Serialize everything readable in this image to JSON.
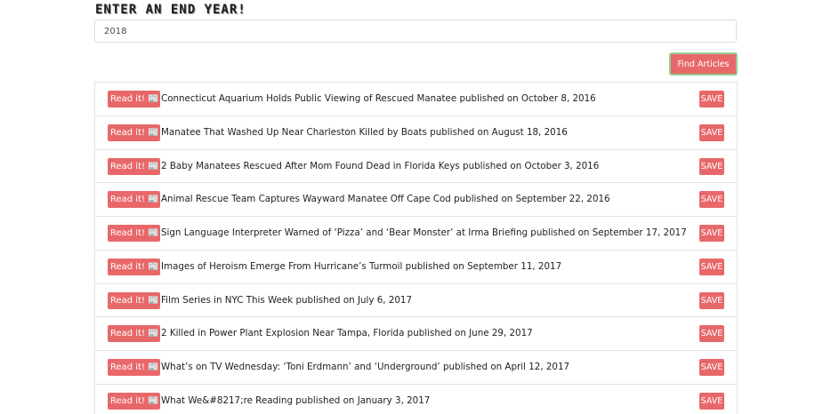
{
  "search": {
    "heading": "Enter an End Year!",
    "end_year_value": "2018",
    "find_button_label": "Find Articles"
  },
  "articles": {
    "read_label": "Read it!",
    "read_icon": "newspaper-icon",
    "save_label": "SAVE",
    "items": [
      {
        "title": "Connecticut Aquarium Holds Public Viewing of Rescued Manatee published on October 8, 2016"
      },
      {
        "title": "Manatee That Washed Up Near Charleston Killed by Boats published on August 18, 2016"
      },
      {
        "title": "2 Baby Manatees Rescued After Mom Found Dead in Florida Keys published on October 3, 2016"
      },
      {
        "title": "Animal Rescue Team Captures Wayward Manatee Off Cape Cod published on September 22, 2016"
      },
      {
        "title": "Sign Language Interpreter Warned of ‘Pizza’ and ‘Bear Monster’ at Irma Briefing published on September 17, 2017"
      },
      {
        "title": "Images of Heroism Emerge From Hurricane’s Turmoil published on September 11, 2017"
      },
      {
        "title": "Film Series in NYC This Week published on July 6, 2017"
      },
      {
        "title": "2 Killed in Power Plant Explosion Near Tampa, Florida published on June 29, 2017"
      },
      {
        "title": "What’s on TV Wednesday: ‘Toni Erdmann’ and ‘Underground’ published on April 12, 2017"
      },
      {
        "title": "What We&#8217;re Reading published on January 3, 2017"
      }
    ]
  },
  "colors": {
    "accent": "#e8686a",
    "button_border": "#8fce92"
  }
}
